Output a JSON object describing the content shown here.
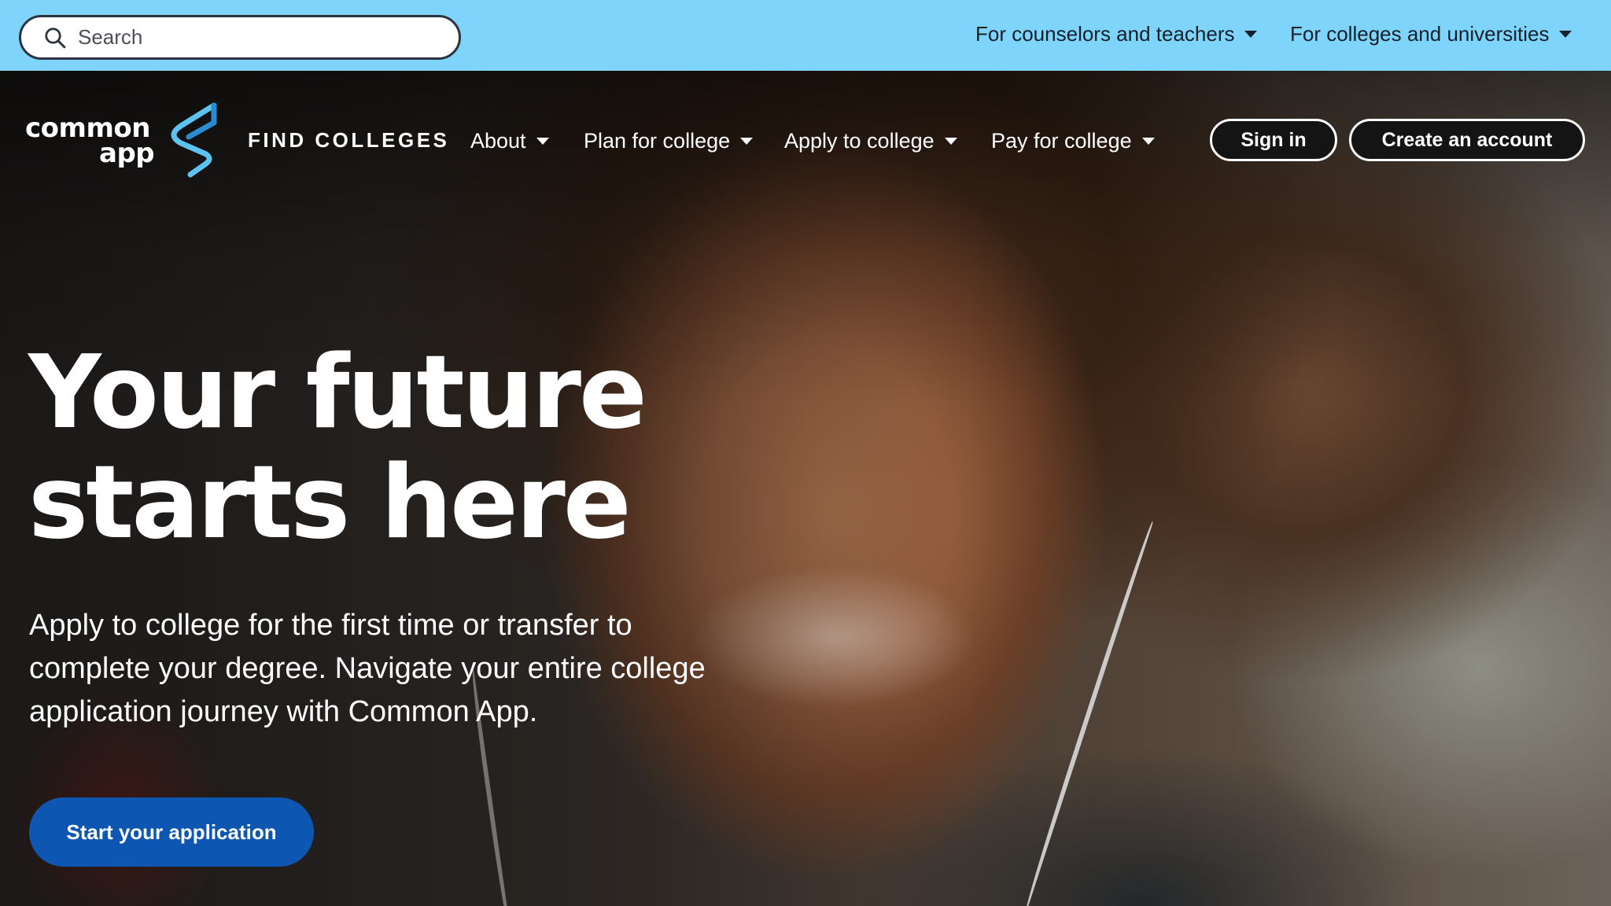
{
  "utility_bar": {
    "background": "#7fd4fb",
    "search": {
      "placeholder": "Search",
      "value": "",
      "icon": "search-icon"
    },
    "links": [
      {
        "label": "For counselors and teachers",
        "icon": "caret-down-icon"
      },
      {
        "label": "For colleges and universities",
        "icon": "caret-down-icon"
      }
    ]
  },
  "nav": {
    "logo": {
      "line1": "common",
      "line2": "app",
      "mark_colors": [
        "#5cc3f0",
        "#2a8bd0"
      ]
    },
    "find_colleges": "FIND COLLEGES",
    "items": [
      {
        "label": "About",
        "icon": "caret-down-icon"
      },
      {
        "label": "Plan for college",
        "icon": "caret-down-icon"
      },
      {
        "label": "Apply to college",
        "icon": "caret-down-icon"
      },
      {
        "label": "Pay for college",
        "icon": "caret-down-icon"
      }
    ],
    "sign_in": "Sign in",
    "create_account": "Create an account"
  },
  "hero": {
    "headline_line1": "Your future",
    "headline_line2": "starts here",
    "subtext": "Apply to college for the first time or transfer to complete your degree. Navigate your entire college application journey with Common App.",
    "cta": "Start your application",
    "cta_color": "#0d57b2"
  }
}
